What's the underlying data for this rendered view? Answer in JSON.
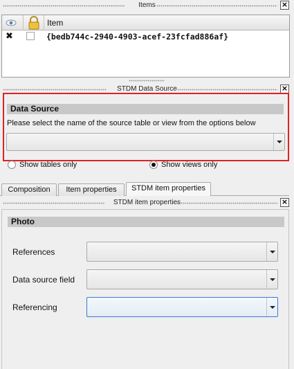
{
  "items_dock": {
    "title": "Items",
    "column_visible_icon": "eye-icon",
    "column_lock_icon": "lock-icon",
    "column_item": "Item",
    "rows": [
      {
        "visible_mark": "✖",
        "locked": false,
        "item": "{bedb744c-2940-4903-acef-23fcfad886af}"
      }
    ]
  },
  "data_source_dock": {
    "title": "STDM Data Source",
    "section_title": "Data Source",
    "instruction": "Please select the name of the source table or view from the options below",
    "source_combo_value": "",
    "radio_tables_label": "Show tables only",
    "radio_views_label": "Show views only",
    "selected_radio": "views",
    "highlight_color": "#e02020"
  },
  "tabs": {
    "items": [
      "Composition",
      "Item properties",
      "STDM item properties"
    ],
    "active": "STDM item properties"
  },
  "item_props_dock": {
    "title": "STDM item properties",
    "section_title": "Photo",
    "fields": [
      {
        "label": "References",
        "value": ""
      },
      {
        "label": "Data source field",
        "value": ""
      },
      {
        "label": "Referencing",
        "value": ""
      }
    ],
    "focus_color": "#3b78d0"
  }
}
